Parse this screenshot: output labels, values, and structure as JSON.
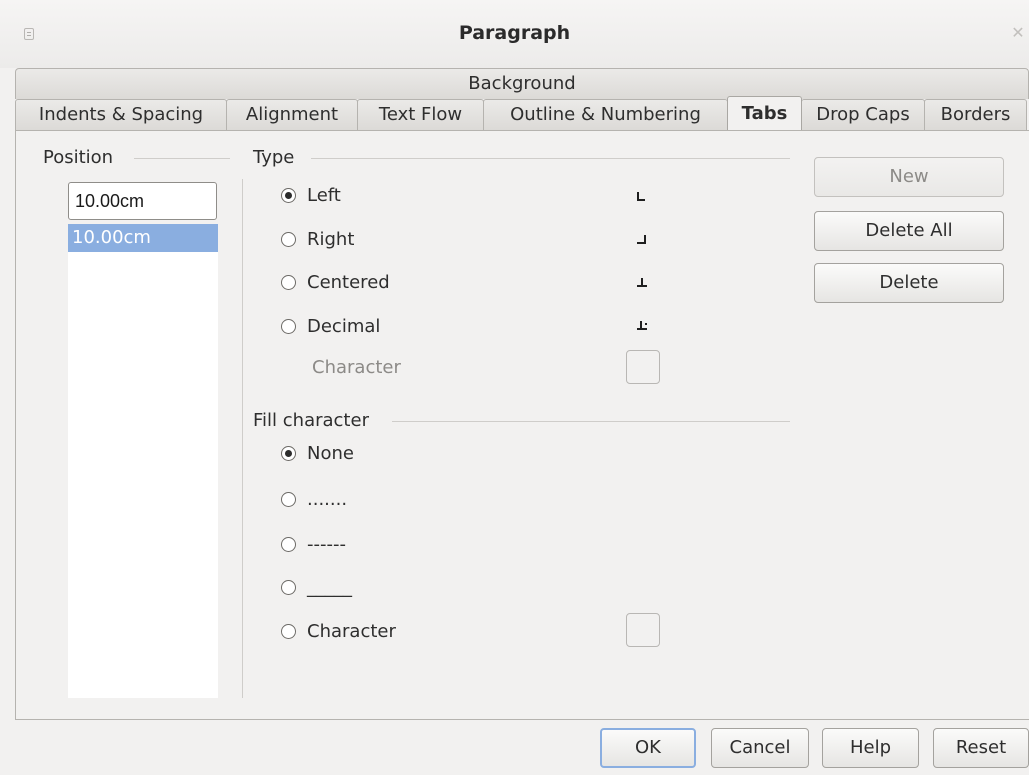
{
  "window": {
    "title": "Paragraph"
  },
  "tabs": {
    "top_row": [
      "Background"
    ],
    "bottom_row": [
      "Indents & Spacing",
      "Alignment",
      "Text Flow",
      "Outline & Numbering",
      "Tabs",
      "Drop Caps",
      "Borders"
    ],
    "active": "Tabs"
  },
  "position": {
    "label": "Position",
    "input_value": "10.00cm",
    "list": [
      "10.00cm"
    ],
    "selected": "10.00cm"
  },
  "type": {
    "label": "Type",
    "options": [
      {
        "label": "Left",
        "checked": true,
        "icon": "tab-left-icon"
      },
      {
        "label": "Right",
        "checked": false,
        "icon": "tab-right-icon"
      },
      {
        "label": "Centered",
        "checked": false,
        "icon": "tab-center-icon"
      },
      {
        "label": "Decimal",
        "checked": false,
        "icon": "tab-decimal-icon"
      }
    ],
    "character_label": "Character",
    "character_value": ""
  },
  "fill": {
    "label": "Fill character",
    "options": [
      {
        "label": "None",
        "checked": true
      },
      {
        "label": ".......",
        "checked": false
      },
      {
        "label": "------",
        "checked": false
      },
      {
        "label": "_____",
        "checked": false
      },
      {
        "label": "Character",
        "checked": false
      }
    ],
    "character_value": ""
  },
  "side_buttons": {
    "new": "New",
    "delete_all": "Delete All",
    "delete": "Delete"
  },
  "footer_buttons": {
    "ok": "OK",
    "cancel": "Cancel",
    "help": "Help",
    "reset": "Reset"
  }
}
